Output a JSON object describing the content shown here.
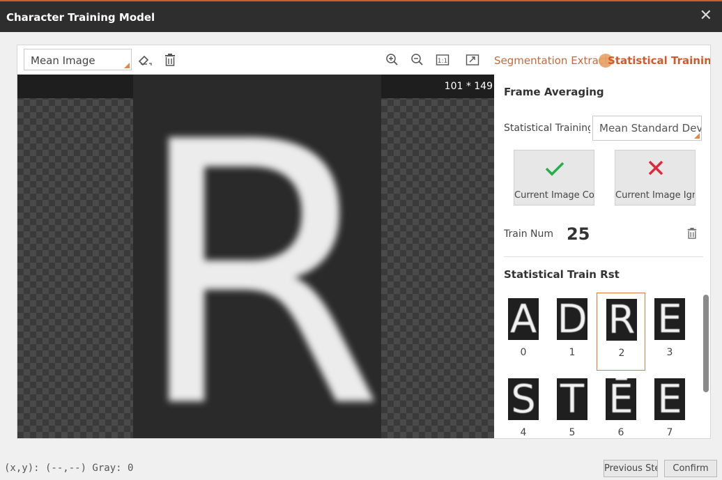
{
  "window": {
    "title": "Character Training Model",
    "close_symbol": "✕"
  },
  "toolbar": {
    "view_select": "Mean Image",
    "icons": [
      "eraser-icon",
      "delete-icon",
      "zoom-in-icon",
      "zoom-out-icon",
      "actual-size-icon",
      "fit-window-icon"
    ],
    "actual_size_label": "1:1"
  },
  "canvas": {
    "image_size": "101 * 149",
    "character": "R"
  },
  "tabs": {
    "segmentation_label": "Segmentation Extract",
    "statistical_label": "Statistical Training"
  },
  "frame_averaging": {
    "title": "Frame Averaging",
    "statistical_training_label": "Statistical Training",
    "method_value": "Mean Standard Deviation",
    "count_button_label": "Current Image Count",
    "ignore_button_label": "Current Image Ignore",
    "train_num_label": "Train Num",
    "train_num_value": "25"
  },
  "results": {
    "title": "Statistical Train Rst",
    "items": [
      {
        "char": "A",
        "index": "0"
      },
      {
        "char": "D",
        "index": "1"
      },
      {
        "char": "R",
        "index": "2"
      },
      {
        "char": "E",
        "index": "3"
      },
      {
        "char": "S",
        "index": "4"
      },
      {
        "char": "T",
        "index": "5"
      },
      {
        "char": "Ē",
        "index": "6"
      },
      {
        "char": "E",
        "index": "7"
      }
    ],
    "selected_index": "2"
  },
  "status": {
    "coords": "(x,y): (--,--) Gray: 0"
  },
  "footer": {
    "previous_label": "Previous Step",
    "confirm_label": "Confirm"
  },
  "colors": {
    "accent": "#d05a2c",
    "check": "#22b04a",
    "cross": "#e0283c",
    "titlebar": "#2e2e2e"
  }
}
